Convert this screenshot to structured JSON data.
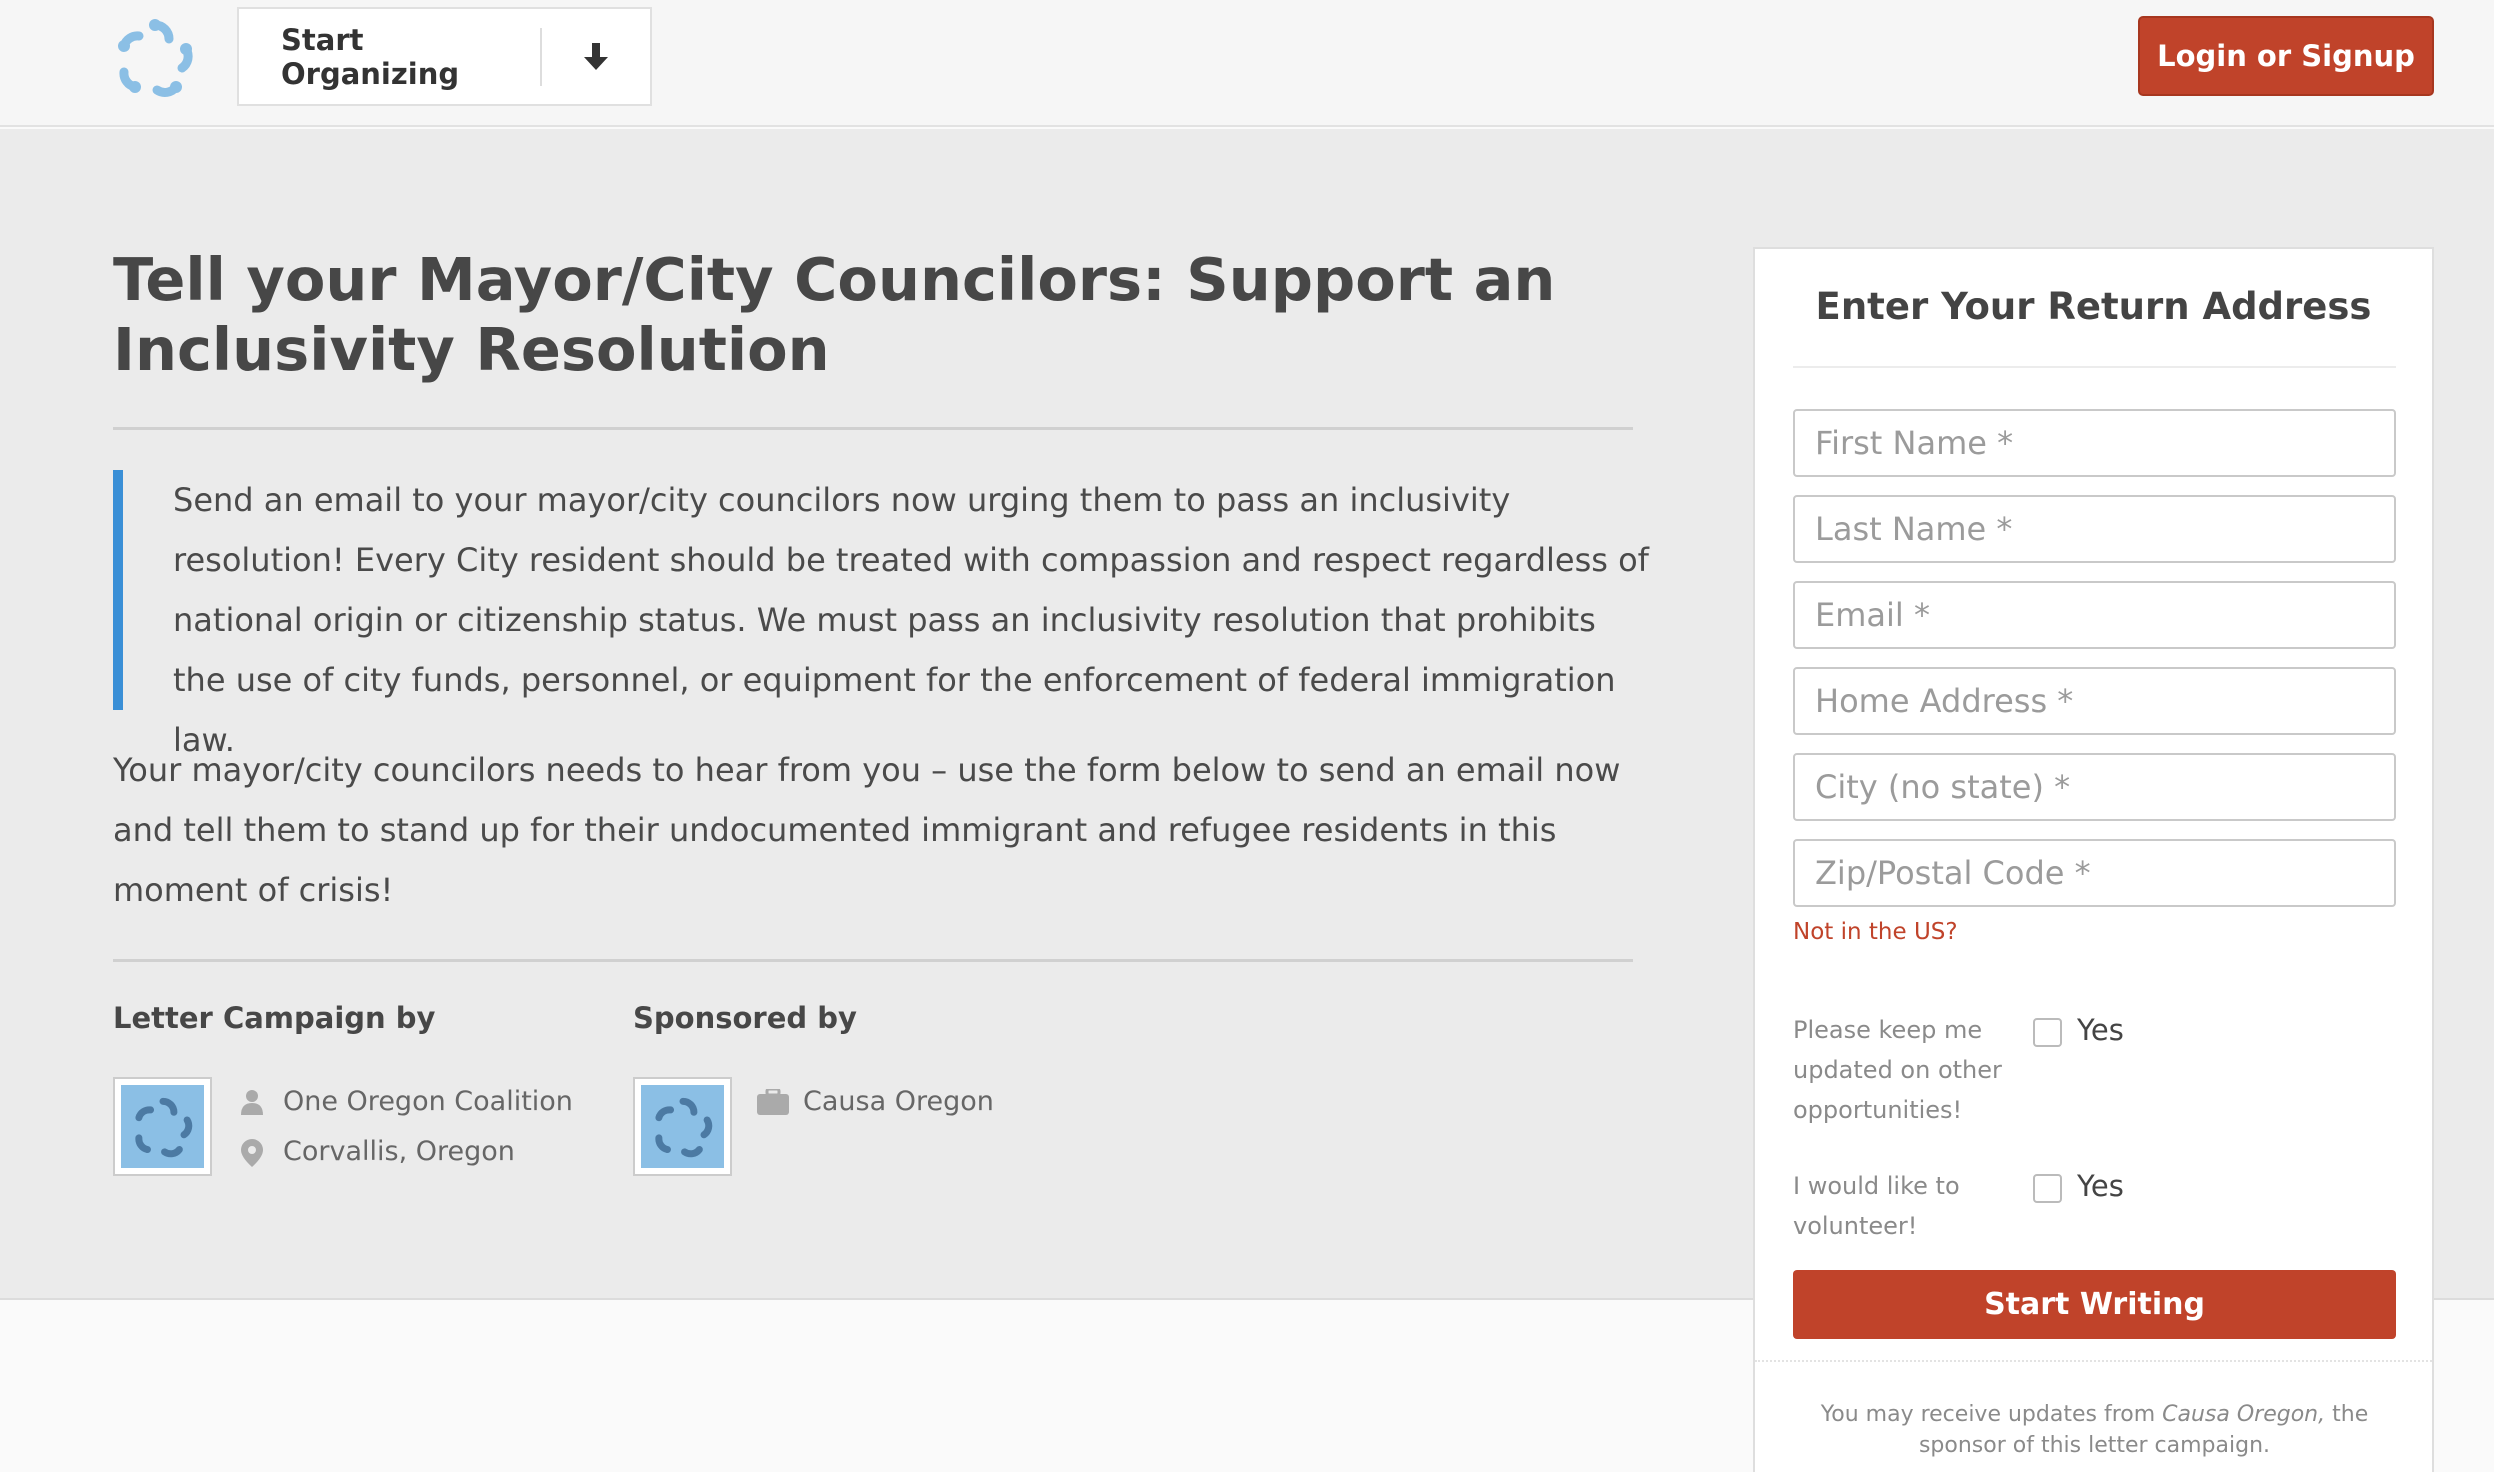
{
  "header": {
    "logo_icon": "pinwheel-logo-icon",
    "organize_label": "Start Organizing",
    "organize_icon": "arrow-down-icon",
    "login_label": "Login or Signup"
  },
  "campaign": {
    "title": "Tell your Mayor/City Councilors: Support an Inclusivity Resolution",
    "quote": "Send an email to your mayor/city councilors now urging them to pass an inclusivity resolution! Every City resident should be treated with compassion and respect regardless of national origin or citizenship status. We must pass an inclusivity resolution that prohibits the use of city funds, personnel, or equipment for the enforcement of federal immigration law.",
    "paragraph": "Your mayor/city councilors needs to hear from you – use the form below to send an email now and tell them to stand up  for their undocumented immigrant  and refugee residents in this moment of crisis!",
    "letter_by_label": "Letter Campaign by",
    "letter_by_org": "One Oregon Coalition",
    "letter_by_location": "Corvallis, Oregon",
    "sponsored_by_label": "Sponsored by",
    "sponsor_org": "Causa Oregon"
  },
  "form": {
    "title": "Enter Your Return Address",
    "first_name_placeholder": "First Name *",
    "last_name_placeholder": "Last Name *",
    "email_placeholder": "Email *",
    "address_placeholder": "Home Address *",
    "city_placeholder": "City (no state) *",
    "zip_placeholder": "Zip/Postal Code *",
    "not_us_link": "Not in the US?",
    "updates_question": "Please keep me updated on other opportunities!",
    "updates_option": "Yes",
    "volunteer_question": "I would like to volunteer!",
    "volunteer_option": "Yes",
    "submit_label": "Start Writing",
    "disclaimer_prefix": "You may receive updates from ",
    "disclaimer_org": "Causa Oregon,",
    "disclaimer_suffix": " the sponsor of this letter campaign."
  },
  "colors": {
    "accent_red": "#c0432a",
    "quote_bar_blue": "#3a8fd6",
    "logo_blue": "#8bbfe5"
  }
}
